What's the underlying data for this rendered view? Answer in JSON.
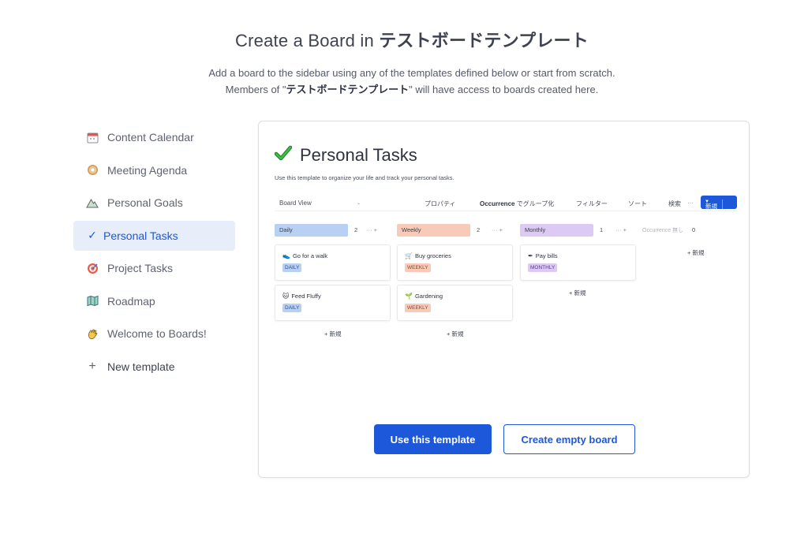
{
  "header": {
    "title_prefix": "Create a Board in ",
    "team_name": "テストボードテンプレート",
    "subtitle_line1": "Add a board to the sidebar using any of the templates defined below or start from scratch.",
    "subtitle_line2_prefix": "Members of \"",
    "subtitle_line2_suffix": "\" will have access to boards created here."
  },
  "sidebar": {
    "items": [
      {
        "label": "Content Calendar",
        "icon": "calendar-icon"
      },
      {
        "label": "Meeting Agenda",
        "icon": "donut-icon"
      },
      {
        "label": "Personal Goals",
        "icon": "mountain-icon"
      },
      {
        "label": "Personal Tasks",
        "icon": "check-icon",
        "selected": true
      },
      {
        "label": "Project Tasks",
        "icon": "target-icon"
      },
      {
        "label": "Roadmap",
        "icon": "map-icon"
      },
      {
        "label": "Welcome to Boards!",
        "icon": "wave-icon"
      },
      {
        "label": "New template",
        "icon": "plus-icon"
      }
    ]
  },
  "preview": {
    "title": "Personal Tasks",
    "description": "Use this template to organize your life and track your personal tasks.",
    "toolbar": {
      "view": "Board View",
      "properties": "プロパティ",
      "group_by_prefix": "Occurrence",
      "group_by_suffix": " でグループ化",
      "filter": "フィルター",
      "sort": "ソート",
      "search": "検索",
      "more": "···",
      "new": "新規"
    },
    "groups": [
      {
        "name": "Daily",
        "count": "2",
        "color": "#b7d0f4"
      },
      {
        "name": "Weekly",
        "count": "2",
        "color": "#f8cbb8"
      },
      {
        "name": "Monthly",
        "count": "1",
        "color": "#dccaf5"
      }
    ],
    "hidden_group": {
      "name": "Occurrence 無し",
      "count": "0"
    },
    "cards": [
      {
        "title": "Go for a walk",
        "tag": "DAILY",
        "icon": "shoe-icon"
      },
      {
        "title": "Feed Fluffy",
        "tag": "DAILY",
        "icon": "cat-icon"
      },
      {
        "title": "Buy groceries",
        "tag": "WEEKLY",
        "icon": "cart-icon"
      },
      {
        "title": "Gardening",
        "tag": "WEEKLY",
        "icon": "plant-icon"
      },
      {
        "title": "Pay bills",
        "tag": "MONTHLY",
        "icon": "pen-icon"
      }
    ],
    "add_label": "+ 新規",
    "group_action": "···  +"
  },
  "buttons": {
    "use_template": "Use this template",
    "create_empty": "Create empty board"
  },
  "colors": {
    "accent": "#1c58d9",
    "selected_bg": "#e7eefa",
    "check_green": "#2e9c3a"
  }
}
